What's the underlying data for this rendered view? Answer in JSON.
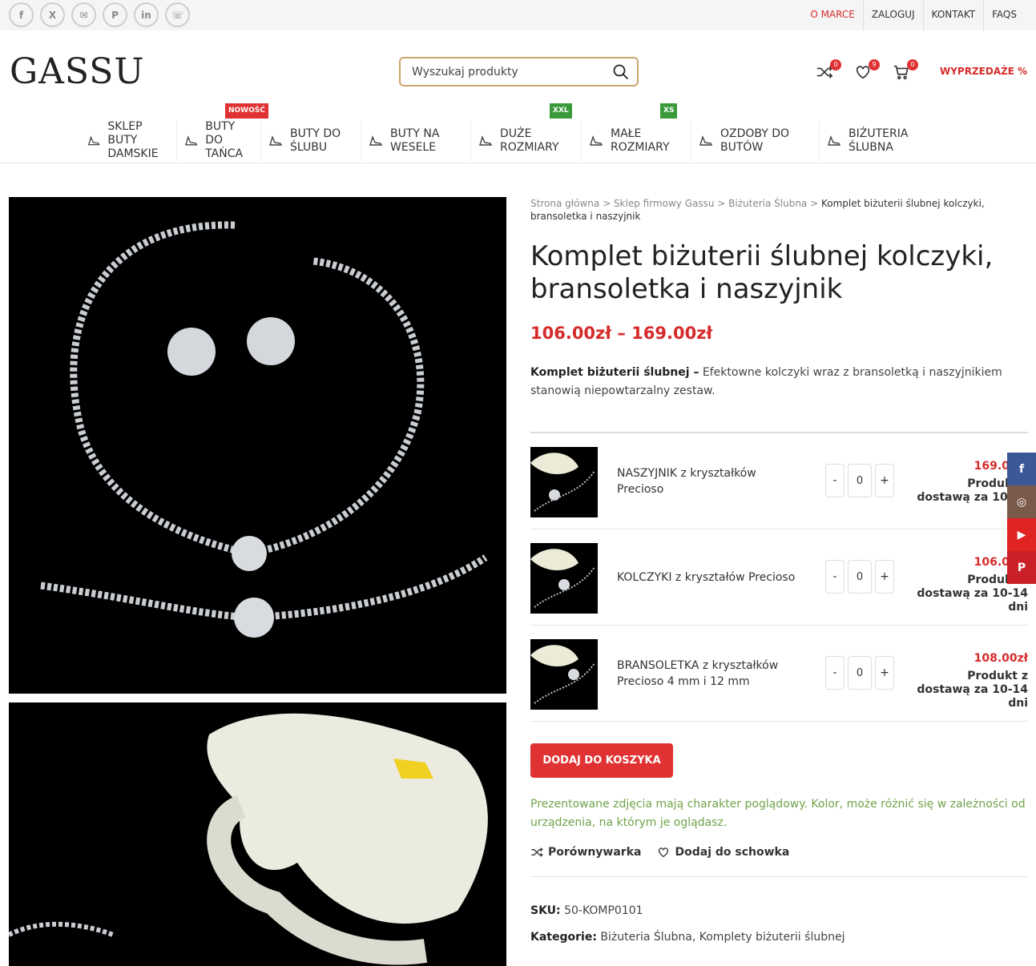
{
  "topbar": {
    "social": [
      {
        "icon": "facebook-icon",
        "glyph": "f"
      },
      {
        "icon": "x-icon",
        "glyph": "X"
      },
      {
        "icon": "mail-icon",
        "glyph": "✉"
      },
      {
        "icon": "pinterest-icon",
        "glyph": "P"
      },
      {
        "icon": "linkedin-icon",
        "glyph": "in"
      },
      {
        "icon": "whatsapp-icon",
        "glyph": "☏"
      }
    ],
    "links": [
      "O MARCE",
      "ZALOGUJ",
      "KONTAKT",
      "FAQS"
    ]
  },
  "header": {
    "logo": "GASSU",
    "search_placeholder": "Wyszukaj produkty",
    "compare_count": "0",
    "wishlist_count": "9",
    "cart_count": "0",
    "sale_label": "WYPRZEDAŻE %"
  },
  "nav": [
    {
      "l1": "SKLEP BUTY",
      "l2": "DAMSKIE",
      "tag": "",
      "tag_color": ""
    },
    {
      "l1": "BUTY DO",
      "l2": "TAŃCA",
      "tag": "NOWOŚĆ",
      "tag_color": "#e03232"
    },
    {
      "l1": "BUTY DO",
      "l2": "ŚLUBU",
      "tag": "",
      "tag_color": ""
    },
    {
      "l1": "BUTY NA",
      "l2": "WESELE",
      "tag": "",
      "tag_color": ""
    },
    {
      "l1": "DUŻE",
      "l2": "ROZMIARY",
      "tag": "XXL",
      "tag_color": "#3a9a3a"
    },
    {
      "l1": "MAŁE",
      "l2": "ROZMIARY",
      "tag": "XS",
      "tag_color": "#3a9a3a"
    },
    {
      "l1": "OZDOBY DO",
      "l2": "BUTÓW",
      "tag": "",
      "tag_color": ""
    },
    {
      "l1": "BIŻUTERIA",
      "l2": "ŚLUBNA",
      "tag": "",
      "tag_color": ""
    }
  ],
  "breadcrumb": {
    "home": "Strona główna",
    "shop": "Sklep firmowy Gassu",
    "cat": "Biżuteria Ślubna",
    "current": "Komplet biżuterii ślubnej kolczyki, bransoletka i naszyjnik"
  },
  "product": {
    "title": "Komplet biżuterii ślubnej kolczyki, bransoletka i naszyjnik",
    "price": "106.00zł – 169.00zł",
    "desc_bold": "Komplet biżuterii ślubnej –",
    "desc_rest": " Efektowne kolczyki wraz z bransoletką i naszyjnikiem stanowią niepowtarzalny zestaw.",
    "items": [
      {
        "name": "NASZYJNIK z kryształków Precioso",
        "qty": "0",
        "price": "169.00zł",
        "avail": "Produkt z dostawą za 10-14 dni"
      },
      {
        "name": "KOLCZYKI z kryształów Precioso",
        "qty": "0",
        "price": "106.00zł",
        "avail": "Produkt z dostawą za 10-14 dni"
      },
      {
        "name": "BRANSOLETKA z kryształków Precioso 4 mm i 12 mm",
        "qty": "0",
        "price": "108.00zł",
        "avail": "Produkt z dostawą za 10-14 dni"
      }
    ],
    "add_to_cart": "DODAJ DO KOSZYKA",
    "note": "Prezentowane zdjęcia mają charakter poglądowy. Kolor, może różnić się w zależności od urządzenia, na którym je oglądasz.",
    "compare": "Porównywarka",
    "wishlist": "Dodaj do schowka",
    "sku_label": "SKU:",
    "sku": "50-KOMP0101",
    "cat_label": "Kategorie:",
    "cats": "Biżuteria Ślubna, Komplety biżuterii ślubnej"
  },
  "sidebar": [
    {
      "icon": "facebook-icon",
      "glyph": "f",
      "color": "#3b5998"
    },
    {
      "icon": "instagram-icon",
      "glyph": "◎",
      "color": "#7a5a4a"
    },
    {
      "icon": "youtube-icon",
      "glyph": "▶",
      "color": "#e02424"
    },
    {
      "icon": "pinterest-icon",
      "glyph": "P",
      "color": "#cb2027"
    }
  ]
}
